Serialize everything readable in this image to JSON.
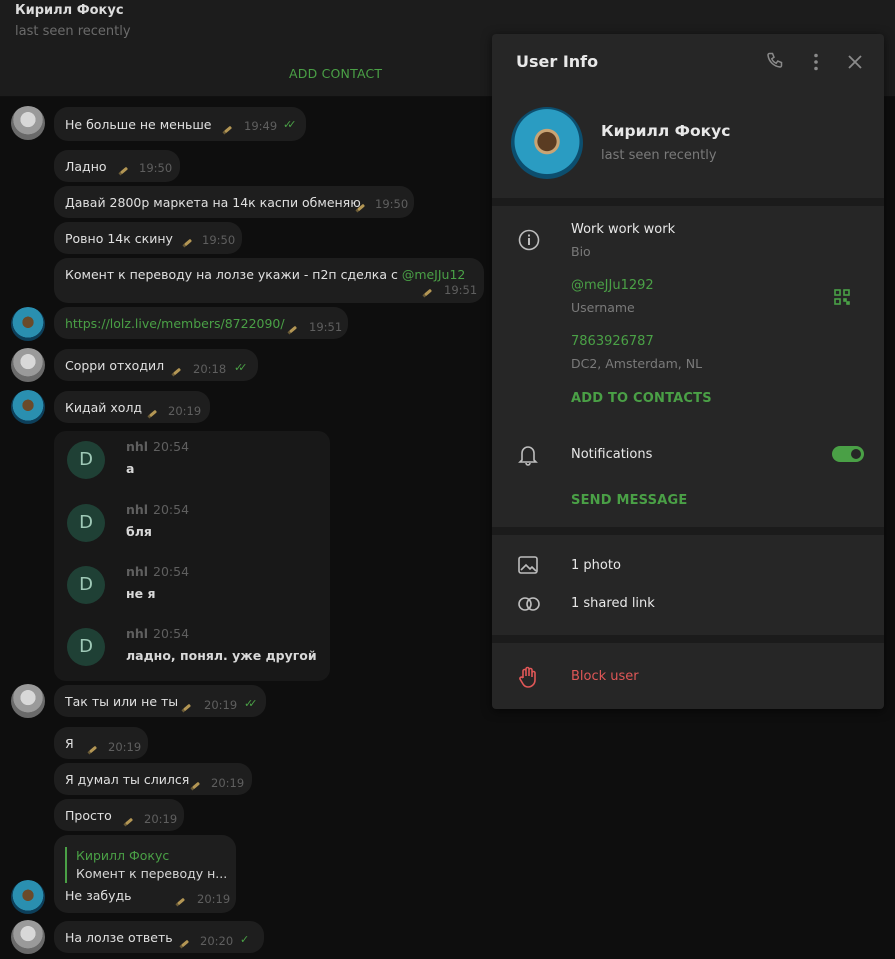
{
  "header": {
    "name": "Кирилл Фокус",
    "status": "last seen recently",
    "add_contact": "ADD CONTACT"
  },
  "messages": [
    {
      "text": "Не больше не меньше",
      "time": "19:49",
      "status": "read"
    },
    {
      "text": "Ладно",
      "time": "19:50"
    },
    {
      "text": "Давай 2800р маркета на 14к каспи обменяю",
      "time": "19:50"
    },
    {
      "text": "Ровно 14к скину",
      "time": "19:50"
    },
    {
      "text": "Комент к переводу на лолзе укажи - п2п сделка с",
      "mention": "@meJJu12",
      "time": "19:51"
    },
    {
      "text": "https://lolz.live/members/8722090/",
      "time": "19:51"
    },
    {
      "text": "Сорри отходил",
      "time": "20:18",
      "status": "read"
    },
    {
      "text": "Кидай холд",
      "time": "20:19"
    },
    {
      "text": "Так ты или не ты",
      "time": "20:19",
      "status": "read"
    },
    {
      "text": "Я",
      "time": "20:19"
    },
    {
      "text": "Я думал ты слился",
      "time": "20:19"
    },
    {
      "text": "Просто",
      "time": "20:19"
    },
    {
      "text": "Не забудь",
      "time": "20:19",
      "reply_name": "Кирилл Фокус",
      "reply_text": "Комент к переводу н..."
    },
    {
      "text": "На лолзе ответь",
      "time": "20:20",
      "status": "sent"
    }
  ],
  "forwarded": [
    {
      "avatar": "D",
      "name": "nhl",
      "time": "20:54",
      "text": "а"
    },
    {
      "avatar": "D",
      "name": "nhl",
      "time": "20:54",
      "text": "бля"
    },
    {
      "avatar": "D",
      "name": "nhl",
      "time": "20:54",
      "text": "не я"
    },
    {
      "avatar": "D",
      "name": "nhl",
      "time": "20:54",
      "text": "ладно, понял. уже другой"
    }
  ],
  "user_info": {
    "title": "User Info",
    "name": "Кирилл Фокус",
    "status": "last seen recently",
    "bio": "Work work work",
    "bio_label": "Bio",
    "username": "@meJJu1292",
    "username_label": "Username",
    "phone": "7863926787",
    "dc": "DC2, Amsterdam, NL",
    "add_to_contacts": "ADD TO CONTACTS",
    "notifications": "Notifications",
    "notifications_on": true,
    "send_message": "SEND MESSAGE",
    "photos": "1 photo",
    "links": "1 shared link",
    "block": "Block user"
  },
  "colors": {
    "accent": "#4aa046",
    "danger": "#e05757",
    "panel": "#262626"
  }
}
